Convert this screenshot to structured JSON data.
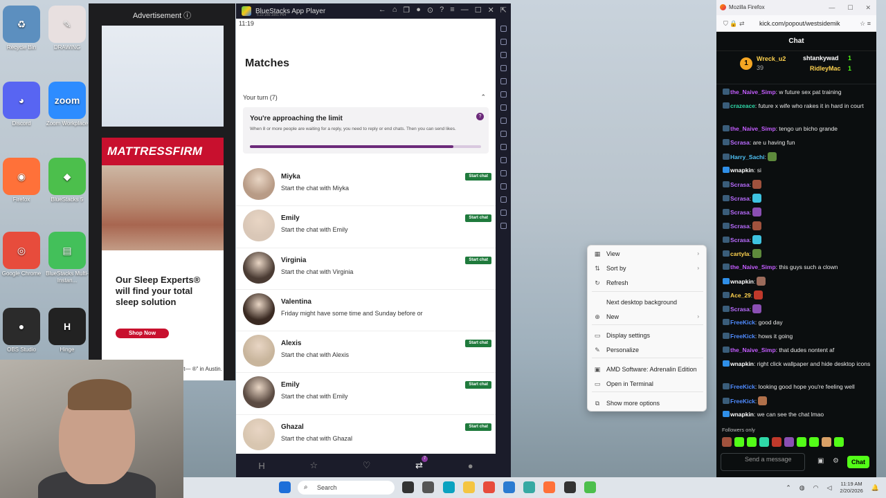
{
  "desktop": {
    "icons": [
      {
        "label": "Recycle Bin",
        "color": "#5c8fbf",
        "glyph": "♻"
      },
      {
        "label": "DRAWING",
        "color": "#e8e0e0",
        "glyph": "✎"
      },
      {
        "label": "Discord",
        "color": "#5865f2",
        "glyph": "◕"
      },
      {
        "label": "Zoom Workplace",
        "color": "#2d8cff",
        "glyph": "zoom"
      },
      {
        "label": "Firefox",
        "color": "#ff7139",
        "glyph": "◉"
      },
      {
        "label": "BlueStacks 5",
        "color": "#4cbf4c",
        "glyph": "◆"
      },
      {
        "label": "Google Chrome",
        "color": "#e74c3c",
        "glyph": "◎"
      },
      {
        "label": "BlueStacks Multi-Instan...",
        "color": "#43c05a",
        "glyph": "▤"
      },
      {
        "label": "OBS Studio",
        "color": "#2b2b2b",
        "glyph": "●"
      },
      {
        "label": "Hinge",
        "color": "#222222",
        "glyph": "H"
      }
    ]
  },
  "ad": {
    "title": "Advertisement ⓘ",
    "brand": "MATTRESSFIRM",
    "headline": "Our Sleep Experts® will find your total sleep solution",
    "button": "Shop Now",
    "footer": "Cozy up to better rest— ®” in Austin."
  },
  "bluestacks": {
    "title": "BlueStacks App Player",
    "subtitle": "5.22.160.1001 P64",
    "controls": [
      "←",
      "⌂",
      "❐",
      "●",
      "⊙",
      "?",
      "≡",
      "—",
      "☐",
      "✕",
      "⇱"
    ],
    "phone": {
      "status_time": "11:19",
      "title": "Matches",
      "your_turn": "Your turn (7)",
      "limit": {
        "title": "You're approaching the limit",
        "description": "When 8 or more people are waiting for a reply, you need to reply or end chats. Then you can send likes.",
        "progress": 0.88
      },
      "matches": [
        {
          "name": "Miyka",
          "sub": "Start the chat with Miyka",
          "button": "Start chat",
          "color": "#b89b86"
        },
        {
          "name": "Emily",
          "sub": "Start the chat with Emily",
          "button": "Start chat",
          "color": "#d9c7b7"
        },
        {
          "name": "Virginia",
          "sub": "Start the chat with Virginia",
          "button": "Start chat",
          "color": "#4a3b33"
        },
        {
          "name": "Valentina",
          "sub": "Friday might have some time and Sunday before or",
          "button": "",
          "color": "#3a2a22"
        },
        {
          "name": "Alexis",
          "sub": "Start the chat with Alexis",
          "button": "Start chat",
          "color": "#c8b59c"
        },
        {
          "name": "Emily",
          "sub": "Start the chat with Emily",
          "button": "Start chat",
          "color": "#5b4b42"
        },
        {
          "name": "Ghazal",
          "sub": "Start the chat with Ghazal",
          "button": "Start chat",
          "color": "#d8c6b0"
        }
      ],
      "nav": [
        "H",
        "☆",
        "♡",
        "⇄",
        "●"
      ],
      "nav_badge": "7"
    }
  },
  "context_menu": {
    "items": [
      {
        "label": "View",
        "icon": "▦",
        "submenu": true
      },
      {
        "label": "Sort by",
        "icon": "⇅",
        "submenu": true
      },
      {
        "label": "Refresh",
        "icon": "↻",
        "submenu": false
      },
      {
        "label": "Next desktop background",
        "icon": "",
        "submenu": false
      },
      {
        "label": "New",
        "icon": "⊕",
        "submenu": true
      },
      {
        "label": "Display settings",
        "icon": "▭",
        "submenu": false
      },
      {
        "label": "Personalize",
        "icon": "✎",
        "submenu": false
      },
      {
        "label": "AMD Software: Adrenalin Edition",
        "icon": "▣",
        "submenu": false
      },
      {
        "label": "Open in Terminal",
        "icon": "▭",
        "submenu": false
      },
      {
        "label": "Show more options",
        "icon": "⧉",
        "submenu": false
      }
    ]
  },
  "firefox": {
    "window_title": "Mozilla Firefox",
    "url": "kick.com/popout/westsidemik",
    "chat_title": "Chat",
    "leaders": [
      {
        "name": "Wreck_u2",
        "count": "39",
        "rank": "1"
      },
      {
        "name": "shtankywad",
        "count": "1"
      },
      {
        "name": "RidleyMac",
        "count": "1"
      }
    ],
    "messages": [
      {
        "user": "the_Naive_Simp",
        "color": "#c45dff",
        "text": ": w future sex pat training"
      },
      {
        "user": "crazeace",
        "color": "#2fd8a8",
        "text": ": future x wife who rakes it in hard in court"
      },
      {
        "user": "the_Naive_Simp",
        "color": "#c45dff",
        "text": ": tengo un bicho grande"
      },
      {
        "user": "Scrasa",
        "color": "#b96cff",
        "text": ": are u having fun"
      },
      {
        "user": "Harry_Sachi",
        "color": "#4fc3f7",
        "text": ":"
      },
      {
        "user": "wnapkin",
        "color": "#ffffff",
        "text": ": si"
      },
      {
        "user": "Scrasa",
        "color": "#b96cff",
        "text": ":"
      },
      {
        "user": "Scrasa",
        "color": "#b96cff",
        "text": ":"
      },
      {
        "user": "Scrasa",
        "color": "#b96cff",
        "text": ":"
      },
      {
        "user": "Scrasa",
        "color": "#b96cff",
        "text": ":"
      },
      {
        "user": "Scrasa",
        "color": "#b96cff",
        "text": ":"
      },
      {
        "user": "cartyla",
        "color": "#ffd34f",
        "text": ":"
      },
      {
        "user": "the_Naive_Simp",
        "color": "#c45dff",
        "text": ": this guys such a clown"
      },
      {
        "user": "wnapkin",
        "color": "#ffffff",
        "text": ":"
      },
      {
        "user": "Ace_29",
        "color": "#ffd34f",
        "text": ":"
      },
      {
        "user": "Scrasa",
        "color": "#b96cff",
        "text": ":"
      },
      {
        "user": "FreeKick",
        "color": "#4f8bff",
        "text": ": good day"
      },
      {
        "user": "FreeKick",
        "color": "#4f8bff",
        "text": ": hows it going"
      },
      {
        "user": "the_Naive_Simp",
        "color": "#c45dff",
        "text": ": that dudes nontent af"
      },
      {
        "user": "wnapkin",
        "color": "#ffffff",
        "text": ": right click wallpaper and hide desktop icons"
      },
      {
        "user": "FreeKick",
        "color": "#4f8bff",
        "text": ": looking good hope you're feeling well"
      },
      {
        "user": "FreeKick",
        "color": "#4f8bff",
        "text": ":"
      },
      {
        "user": "wnapkin",
        "color": "#ffffff",
        "text": ": we can see the chat lmao"
      }
    ],
    "followers_only": "Followers only",
    "send_placeholder": "Send a message",
    "send_button": "Chat"
  },
  "taskbar": {
    "search": "Search",
    "time": "11:19 AM",
    "date": "2/20/2026"
  }
}
